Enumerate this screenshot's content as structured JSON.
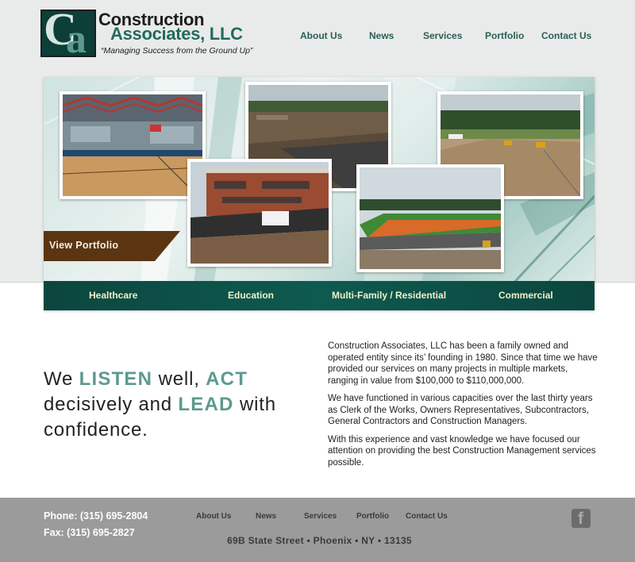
{
  "header": {
    "logo": {
      "mark_letters": "Ca",
      "line1": "Construction",
      "line2": "Associates, LLC",
      "tagline": "“Managing Success from the Ground Up”"
    },
    "nav": [
      "About Us",
      "News",
      "Services",
      "Portfolio",
      "Contact Us"
    ]
  },
  "hero": {
    "view_portfolio": "View Portfolio",
    "categories": [
      "Healthcare",
      "Education",
      "Multi-Family / Residential",
      "Commercial"
    ]
  },
  "intro": {
    "slogan": {
      "p1": "We ",
      "e1": "LISTEN",
      "p2": " well, ",
      "e2": "ACT",
      "p3": " decisively and ",
      "e3": "LEAD",
      "p4": " with confidence."
    },
    "paragraphs": [
      "Construction Associates, LLC has been a family owned and operated entity since its’ founding in 1980. Since that time we have provided our services on many projects in multiple markets, ranging in value from $100,000 to $110,000,000.",
      "We have functioned in various capacities over the last thirty years as Clerk of the Works, Owners Representatives, Subcontractors, General Contractors and Construction Managers.",
      "With this experience and vast knowledge we have focused our attention on providing the best Construction Management services possible."
    ]
  },
  "footer": {
    "phone": "Phone: (315) 695-2804",
    "fax": "Fax: (315) 695-2827",
    "nav": [
      "About Us",
      "News",
      "Services",
      "Portfolio",
      "Contact Us"
    ],
    "address": "69B State Street • Phoenix • NY • 13135",
    "facebook_icon": "f"
  },
  "colors": {
    "accent": "#5c9a8e",
    "nav": "#2c5f57",
    "dark_teal": "#0b463e",
    "footer_bg": "#9b9b9b"
  }
}
